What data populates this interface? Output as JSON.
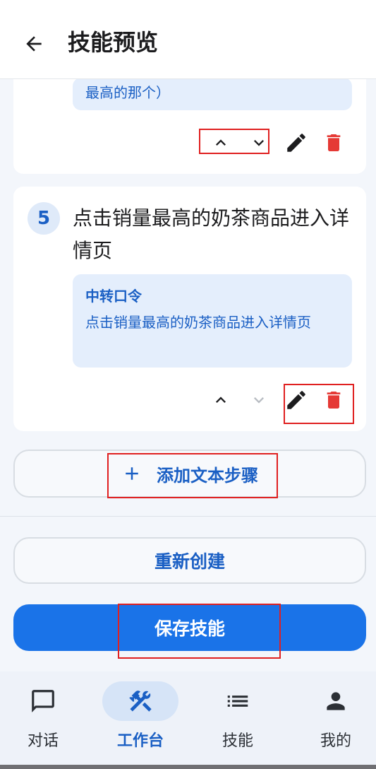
{
  "header": {
    "title": "技能预览",
    "back_icon": "arrow-left-icon"
  },
  "steps": [
    {
      "quote_text": "最高的那个）"
    },
    {
      "number": "5",
      "title": "点击销量最高的奶茶商品进入详情页",
      "quote_label": "中转口令",
      "quote_text": "点击销量最高的奶茶商品进入详情页"
    }
  ],
  "actions": {
    "add_step_label": "添加文本步骤",
    "recreate_label": "重新创建",
    "save_label": "保存技能"
  },
  "bottom_nav": {
    "items": [
      {
        "label": "对话",
        "icon": "chat-icon",
        "active": false
      },
      {
        "label": "工作台",
        "icon": "tools-icon",
        "active": true
      },
      {
        "label": "技能",
        "icon": "list-icon",
        "active": false
      },
      {
        "label": "我的",
        "icon": "person-icon",
        "active": false
      }
    ]
  },
  "colors": {
    "accent": "#1a73e8",
    "accent_text": "#1a5fc4",
    "delete": "#e53935",
    "highlight_outline": "#e02020"
  }
}
